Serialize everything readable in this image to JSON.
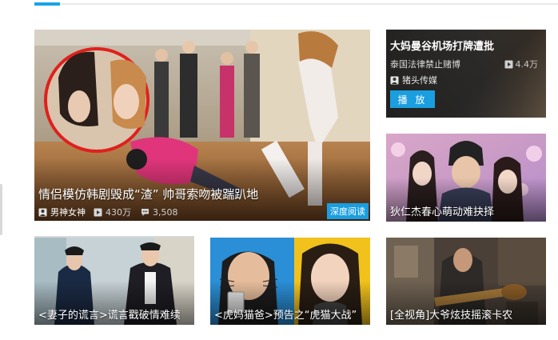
{
  "hero": {
    "title": "情侣模仿韩剧毁成“渣” 帅哥索吻被踹趴地",
    "author": "男神女神",
    "views": "430万",
    "comments": "3,508",
    "badge": "深度阅读",
    "author_icon": "user-icon",
    "views_icon": "play-icon",
    "comments_icon": "comment-icon"
  },
  "side_top": {
    "title": "大妈曼谷机场打牌遭批",
    "subtitle": "泰国法律禁止赌博",
    "views": "4.4万",
    "source": "猪头传媒",
    "play_label": "播 放"
  },
  "cards": [
    {
      "caption": "狄仁杰春心萌动难抉择"
    },
    {
      "caption": "<妻子的谎言>谎言戳破情难续"
    },
    {
      "caption": "<虎妈猫爸>预告之“虎猫大战”"
    },
    {
      "caption": "[全视角]大爷炫技摇滚卡农"
    }
  ],
  "colors": {
    "accent": "#1aa3e8",
    "badge": "#1a9ee0",
    "highlight_circle": "#e0201c"
  }
}
